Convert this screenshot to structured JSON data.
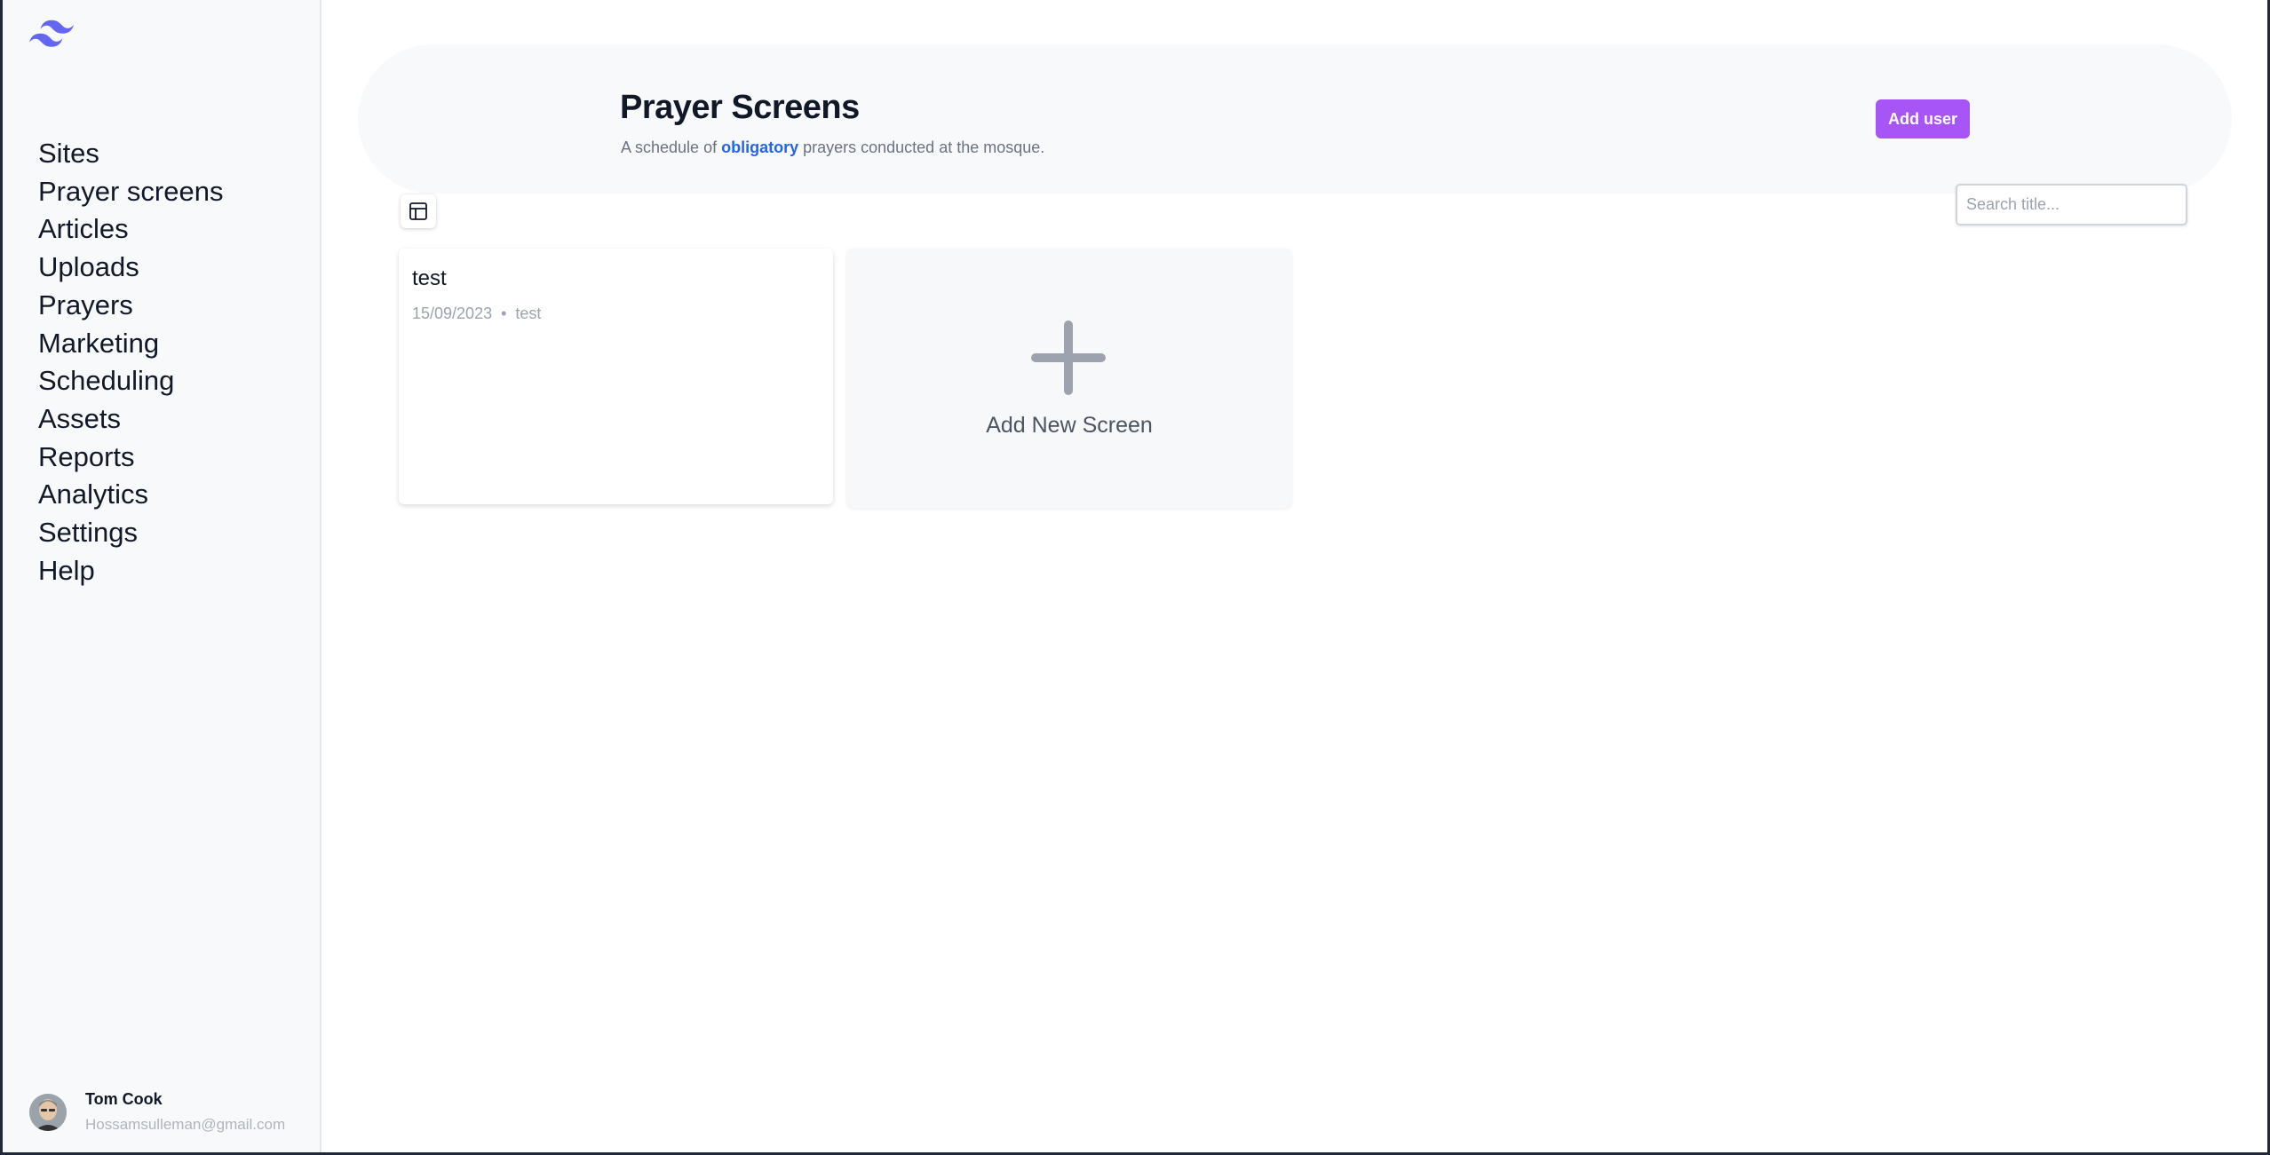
{
  "sidebar": {
    "logo_icon": "tailwind-logo-icon",
    "items": [
      {
        "label": "Sites"
      },
      {
        "label": "Prayer screens"
      },
      {
        "label": "Articles"
      },
      {
        "label": "Uploads"
      },
      {
        "label": "Prayers"
      },
      {
        "label": "Marketing"
      },
      {
        "label": "Scheduling"
      },
      {
        "label": "Assets"
      },
      {
        "label": "Reports"
      },
      {
        "label": "Analytics"
      },
      {
        "label": "Settings"
      },
      {
        "label": "Help"
      }
    ],
    "user": {
      "name": "Tom Cook",
      "email": "Hossamsulleman@gmail.com"
    }
  },
  "header": {
    "title": "Prayer Screens",
    "desc_before": "A schedule of ",
    "desc_highlight": "obligatory",
    "desc_after": " prayers conducted at the mosque.",
    "add_user_label": "Add user"
  },
  "toolbar": {
    "search_placeholder": "Search title...",
    "view_icon": "table-layout-icon"
  },
  "screens": [
    {
      "title": "test",
      "date": "15/09/2023",
      "tag": "test"
    }
  ],
  "add_card": {
    "label": "Add New Screen",
    "icon": "plus-icon"
  },
  "colors": {
    "accent": "#a855f7",
    "link": "#2563eb",
    "logo": "#6366f1"
  }
}
